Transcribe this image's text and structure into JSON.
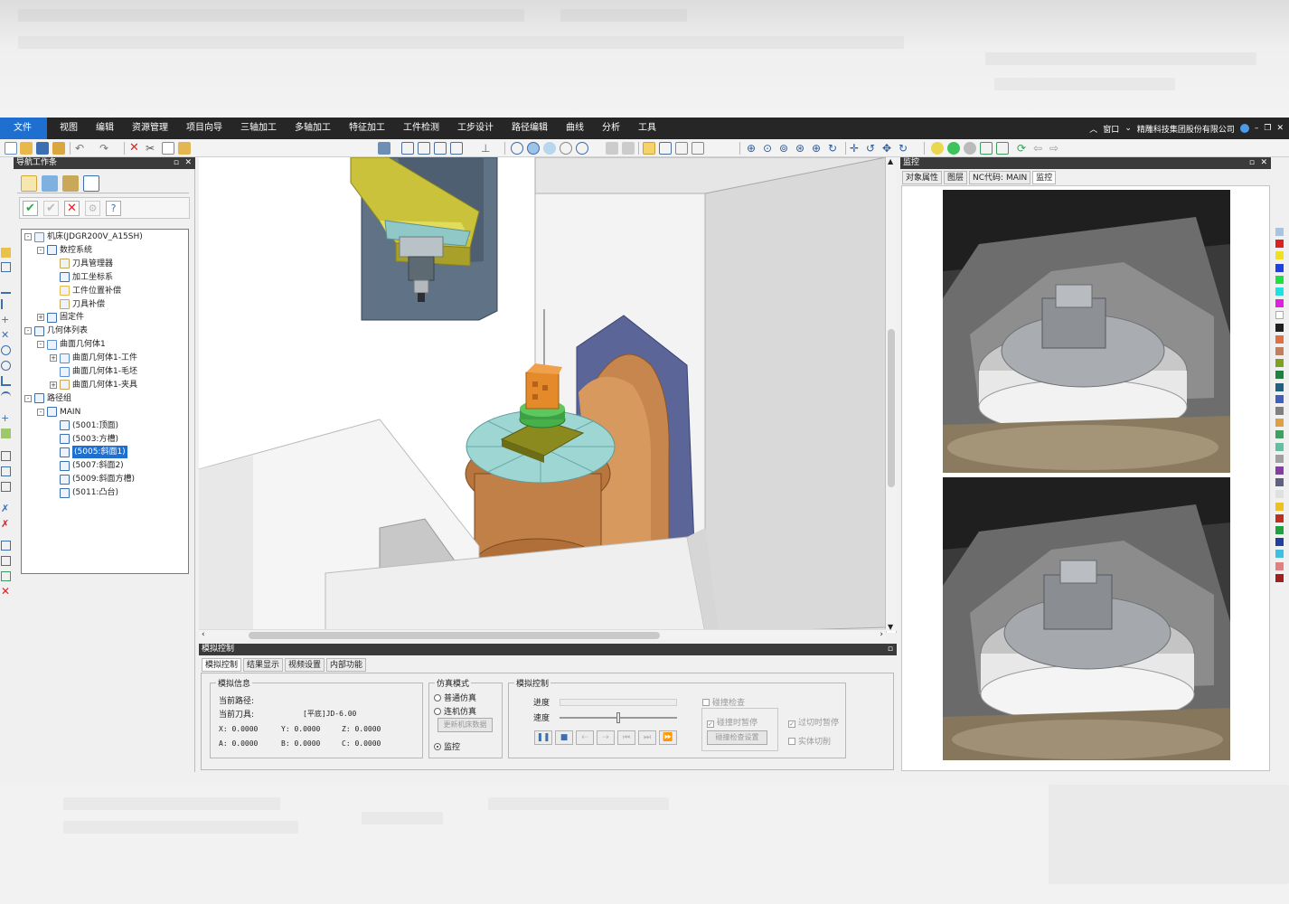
{
  "menu": {
    "file": "文件",
    "items": [
      "视图",
      "编辑",
      "资源管理",
      "项目向导",
      "三轴加工",
      "多轴加工",
      "特征加工",
      "工件检测",
      "工步设计",
      "路径编辑",
      "曲线",
      "分析",
      "工具"
    ],
    "window": "窗口",
    "company": "精雕科技集团股份有限公司"
  },
  "nav": {
    "title": "导航工作条",
    "tree": [
      {
        "label": "机床(JDGR200V_A15SH)",
        "level": 0,
        "expander": "-",
        "icon": "machine-icon"
      },
      {
        "label": "数控系统",
        "level": 1,
        "expander": "-",
        "icon": "cnc-icon"
      },
      {
        "label": "刀具管理器",
        "level": 2,
        "expander": "",
        "icon": "tool-manager-icon"
      },
      {
        "label": "加工坐标系",
        "level": 2,
        "expander": "",
        "icon": "coordinate-icon"
      },
      {
        "label": "工件位置补偿",
        "level": 2,
        "expander": "",
        "icon": "offset-icon"
      },
      {
        "label": "刀具补偿",
        "level": 2,
        "expander": "",
        "icon": "tool-comp-icon"
      },
      {
        "label": "固定件",
        "level": 1,
        "expander": "+",
        "icon": "fixture-icon"
      },
      {
        "label": "几何体列表",
        "level": 0,
        "expander": "-",
        "icon": "geometry-list-icon"
      },
      {
        "label": "曲面几何体1",
        "level": 1,
        "expander": "-",
        "icon": "surface-icon"
      },
      {
        "label": "曲面几何体1-工件",
        "level": 2,
        "expander": "+",
        "icon": "workpiece-icon"
      },
      {
        "label": "曲面几何体1-毛坯",
        "level": 2,
        "expander": "",
        "icon": "blank-icon"
      },
      {
        "label": "曲面几何体1-夹具",
        "level": 2,
        "expander": "+",
        "icon": "clamp-icon"
      },
      {
        "label": "路径组",
        "level": 0,
        "expander": "-",
        "icon": "path-group-icon"
      },
      {
        "label": "MAIN",
        "level": 1,
        "expander": "-",
        "icon": "path-icon"
      },
      {
        "label": "(5001:顶面)",
        "level": 2,
        "expander": "",
        "icon": "path-icon",
        "selected": false
      },
      {
        "label": "(5003:方槽)",
        "level": 2,
        "expander": "",
        "icon": "path-icon",
        "selected": false
      },
      {
        "label": "(5005:斜面1)",
        "level": 2,
        "expander": "",
        "icon": "path-icon",
        "selected": true
      },
      {
        "label": "(5007:斜面2)",
        "level": 2,
        "expander": "",
        "icon": "path-icon",
        "selected": false
      },
      {
        "label": "(5009:斜面方槽)",
        "level": 2,
        "expander": "",
        "icon": "path-icon",
        "selected": false
      },
      {
        "label": "(5011:凸台)",
        "level": 2,
        "expander": "",
        "icon": "path-icon",
        "selected": false
      }
    ]
  },
  "sim": {
    "title": "模拟控制",
    "tabs": [
      "模拟控制",
      "结果显示",
      "视频设置",
      "内部功能"
    ],
    "info": {
      "title": "模拟信息",
      "path_label": "当前路径:",
      "tool_label": "当前刀具:",
      "tool_value": "[平底]JD-6.00",
      "x": "X: 0.0000",
      "y": "Y: 0.0000",
      "z": "Z: 0.0000",
      "a": "A: 0.0000",
      "b": "B: 0.0000",
      "c": "C: 0.0000"
    },
    "mode": {
      "title": "仿真模式",
      "normal": "普通仿真",
      "online": "连机仿真",
      "update_btn": "更新机床数据",
      "monitor": "监控"
    },
    "control": {
      "title": "模拟控制",
      "progress_label": "进度",
      "speed_label": "速度",
      "progress": 0,
      "speed": 0.5,
      "collision_check": "碰撞检查",
      "pause_on_collision": "碰撞时暂停",
      "collision_settings": "碰撞检查设置",
      "pause_on_overcut": "过切时暂停",
      "solid_cut": "实体切削"
    }
  },
  "monitor": {
    "title": "监控",
    "tabs": [
      "对象属性",
      "图层",
      "NC代码: MAIN",
      "监控"
    ]
  },
  "colors": {
    "menubar": "#262626",
    "accent": "#1e6fcf",
    "machine_gray": "#5f7286",
    "spindle_yellow": "#c9c23a",
    "rotary_copper": "#c8864f",
    "table_cyan": "#9ed6d4",
    "workpiece_orange": "#e48a2b"
  }
}
